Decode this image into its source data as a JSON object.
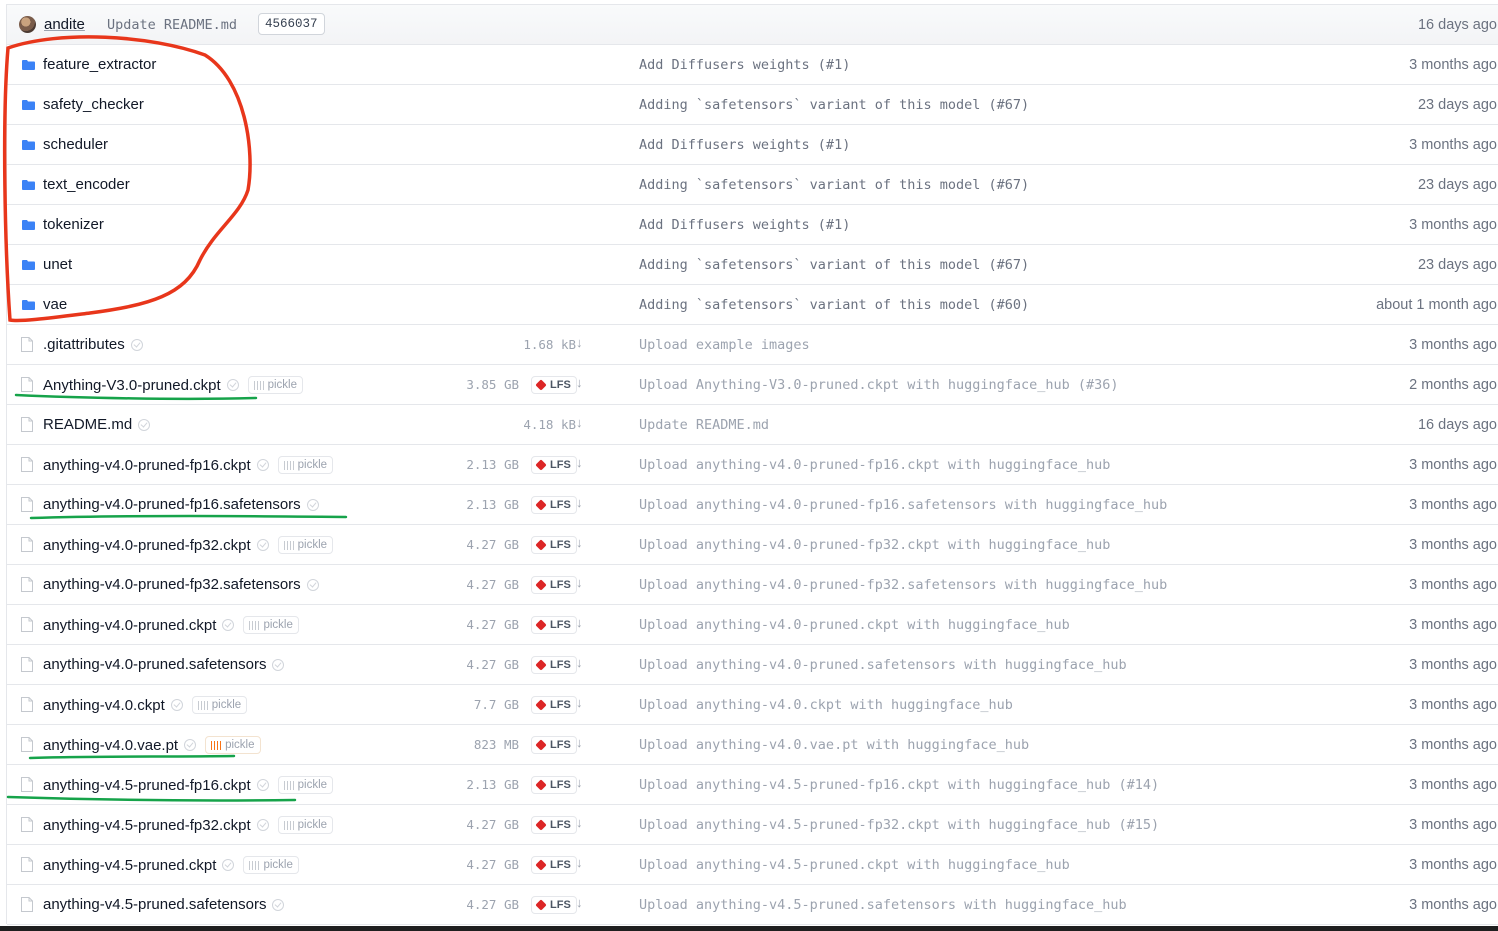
{
  "header": {
    "author": "andite",
    "message": "Update README.md",
    "hash": "4566037",
    "date": "16 days ago"
  },
  "folders": [
    {
      "name": "feature_extractor",
      "message": "Add Diffusers weights (#1)",
      "date": "3 months ago"
    },
    {
      "name": "safety_checker",
      "message": "Adding `safetensors` variant of this model (#67)",
      "date": "23 days ago"
    },
    {
      "name": "scheduler",
      "message": "Add Diffusers weights (#1)",
      "date": "3 months ago"
    },
    {
      "name": "text_encoder",
      "message": "Adding `safetensors` variant of this model (#67)",
      "date": "23 days ago"
    },
    {
      "name": "tokenizer",
      "message": "Add Diffusers weights (#1)",
      "date": "3 months ago"
    },
    {
      "name": "unet",
      "message": "Adding `safetensors` variant of this model (#67)",
      "date": "23 days ago"
    },
    {
      "name": "vae",
      "message": "Adding `safetensors` variant of this model (#60)",
      "date": "about 1 month ago"
    }
  ],
  "labels": {
    "pickle": "pickle",
    "lfs": "LFS",
    "download_icon": "↓"
  },
  "files": [
    {
      "name": ".gitattributes",
      "pickle": false,
      "size": "1.68 kB",
      "lfs": false,
      "message": "Upload example images",
      "date": "3 months ago"
    },
    {
      "name": "Anything-V3.0-pruned.ckpt",
      "pickle": true,
      "size": "3.85 GB",
      "lfs": true,
      "message": "Upload Anything-V3.0-pruned.ckpt with huggingface_hub (#36)",
      "date": "2 months ago"
    },
    {
      "name": "README.md",
      "pickle": false,
      "size": "4.18 kB",
      "lfs": false,
      "message": "Update README.md",
      "date": "16 days ago"
    },
    {
      "name": "anything-v4.0-pruned-fp16.ckpt",
      "pickle": true,
      "size": "2.13 GB",
      "lfs": true,
      "message": "Upload anything-v4.0-pruned-fp16.ckpt with huggingface_hub",
      "date": "3 months ago"
    },
    {
      "name": "anything-v4.0-pruned-fp16.safetensors",
      "pickle": false,
      "size": "2.13 GB",
      "lfs": true,
      "message": "Upload anything-v4.0-pruned-fp16.safetensors with huggingface_hub",
      "date": "3 months ago"
    },
    {
      "name": "anything-v4.0-pruned-fp32.ckpt",
      "pickle": true,
      "size": "4.27 GB",
      "lfs": true,
      "message": "Upload anything-v4.0-pruned-fp32.ckpt with huggingface_hub",
      "date": "3 months ago"
    },
    {
      "name": "anything-v4.0-pruned-fp32.safetensors",
      "pickle": false,
      "size": "4.27 GB",
      "lfs": true,
      "message": "Upload anything-v4.0-pruned-fp32.safetensors with huggingface_hub",
      "date": "3 months ago"
    },
    {
      "name": "anything-v4.0-pruned.ckpt",
      "pickle": true,
      "size": "4.27 GB",
      "lfs": true,
      "message": "Upload anything-v4.0-pruned.ckpt with huggingface_hub",
      "date": "3 months ago"
    },
    {
      "name": "anything-v4.0-pruned.safetensors",
      "pickle": false,
      "size": "4.27 GB",
      "lfs": true,
      "message": "Upload anything-v4.0-pruned.safetensors with huggingface_hub",
      "date": "3 months ago"
    },
    {
      "name": "anything-v4.0.ckpt",
      "pickle": true,
      "size": "7.7 GB",
      "lfs": true,
      "message": "Upload anything-v4.0.ckpt with huggingface_hub",
      "date": "3 months ago"
    },
    {
      "name": "anything-v4.0.vae.pt",
      "pickle": true,
      "pickle_warning": true,
      "size": "823 MB",
      "lfs": true,
      "message": "Upload anything-v4.0.vae.pt with huggingface_hub",
      "date": "3 months ago"
    },
    {
      "name": "anything-v4.5-pruned-fp16.ckpt",
      "pickle": true,
      "size": "2.13 GB",
      "lfs": true,
      "message": "Upload anything-v4.5-pruned-fp16.ckpt with huggingface_hub (#14)",
      "date": "3 months ago"
    },
    {
      "name": "anything-v4.5-pruned-fp32.ckpt",
      "pickle": true,
      "size": "4.27 GB",
      "lfs": true,
      "message": "Upload anything-v4.5-pruned-fp32.ckpt with huggingface_hub (#15)",
      "date": "3 months ago"
    },
    {
      "name": "anything-v4.5-pruned.ckpt",
      "pickle": true,
      "size": "4.27 GB",
      "lfs": true,
      "message": "Upload anything-v4.5-pruned.ckpt with huggingface_hub",
      "date": "3 months ago"
    },
    {
      "name": "anything-v4.5-pruned.safetensors",
      "pickle": false,
      "size": "4.27 GB",
      "lfs": true,
      "message": "Upload anything-v4.5-pruned.safetensors with huggingface_hub",
      "date": "3 months ago"
    }
  ],
  "colors": {
    "folder_icon": "#3b82f6",
    "lfs_icon": "#dc2626",
    "pickle_warning": "#f97316",
    "red_annotation": "#e8361b",
    "green_underline": "#16a34a"
  },
  "icons": {
    "folder": "folder-icon",
    "file": "file-icon",
    "lfs": "lfs-icon",
    "pickle": "pickle-icon",
    "download": "download-icon",
    "check": "check-icon"
  }
}
